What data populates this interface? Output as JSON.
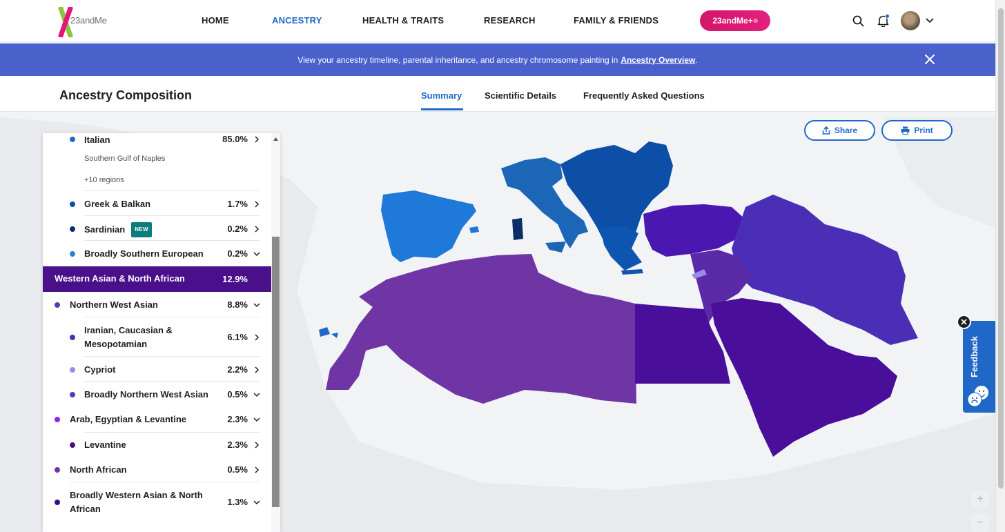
{
  "nav": {
    "logo_text": "23andMe",
    "links": [
      "HOME",
      "ANCESTRY",
      "HEALTH & TRAITS",
      "RESEARCH",
      "FAMILY & FRIENDS"
    ],
    "plus_button": "23andMe+",
    "plus_sup": "®"
  },
  "banner": {
    "text": "View your ancestry timeline, parental inheritance, and ancestry chromosome painting in",
    "link": "Ancestry Overview",
    "suffix": "."
  },
  "subheader": {
    "title": "Ancestry Composition",
    "tabs": [
      "Summary",
      "Scientific Details",
      "Frequently Asked Questions"
    ]
  },
  "actions": {
    "share": "Share",
    "print": "Print"
  },
  "feedback": {
    "label": "Feedback"
  },
  "zoom": {
    "in": "+",
    "out": "−"
  },
  "colors": {
    "italian": "#1f68c8",
    "greek_balkan": "#0d4fa6",
    "sardinian": "#0b2f6b",
    "broad_southern_european": "#2a7fd9",
    "northern_west_asian": "#4a3fb6",
    "cypriot": "#9c8ae8",
    "arab_egyptian_levantine": "#8a2be2",
    "levantine": "#4a0f8a",
    "north_african": "#6f35a5",
    "broad_western_asian": "#3a0b8a",
    "highlight": "#4a0f8a"
  },
  "panel": {
    "italian": {
      "name": "Italian",
      "pct": "85.0%",
      "sub1": "Southern Gulf of Naples",
      "sub2": "+10 regions"
    },
    "greek": {
      "name": "Greek & Balkan",
      "pct": "1.7%"
    },
    "sardinian": {
      "name": "Sardinian",
      "badge": "NEW",
      "pct": "0.2%"
    },
    "broad_se": {
      "name": "Broadly Southern European",
      "pct": "0.2%"
    },
    "wana": {
      "name": "Western Asian & North African",
      "pct": "12.9%"
    },
    "nwa": {
      "name": "Northern West Asian",
      "pct": "8.8%"
    },
    "iranian": {
      "name1": "Iranian, Caucasian &",
      "name2": "Mesopotamian",
      "pct": "6.1%"
    },
    "cypriot": {
      "name": "Cypriot",
      "pct": "2.2%"
    },
    "broad_nwa": {
      "name": "Broadly Northern West Asian",
      "pct": "0.5%"
    },
    "arab": {
      "name": "Arab, Egyptian & Levantine",
      "pct": "2.3%"
    },
    "levantine": {
      "name": "Levantine",
      "pct": "2.3%"
    },
    "north_african": {
      "name": "North African",
      "pct": "0.5%"
    },
    "broad_wana": {
      "name1": "Broadly Western Asian & North",
      "name2": "African",
      "pct": "1.3%"
    }
  }
}
